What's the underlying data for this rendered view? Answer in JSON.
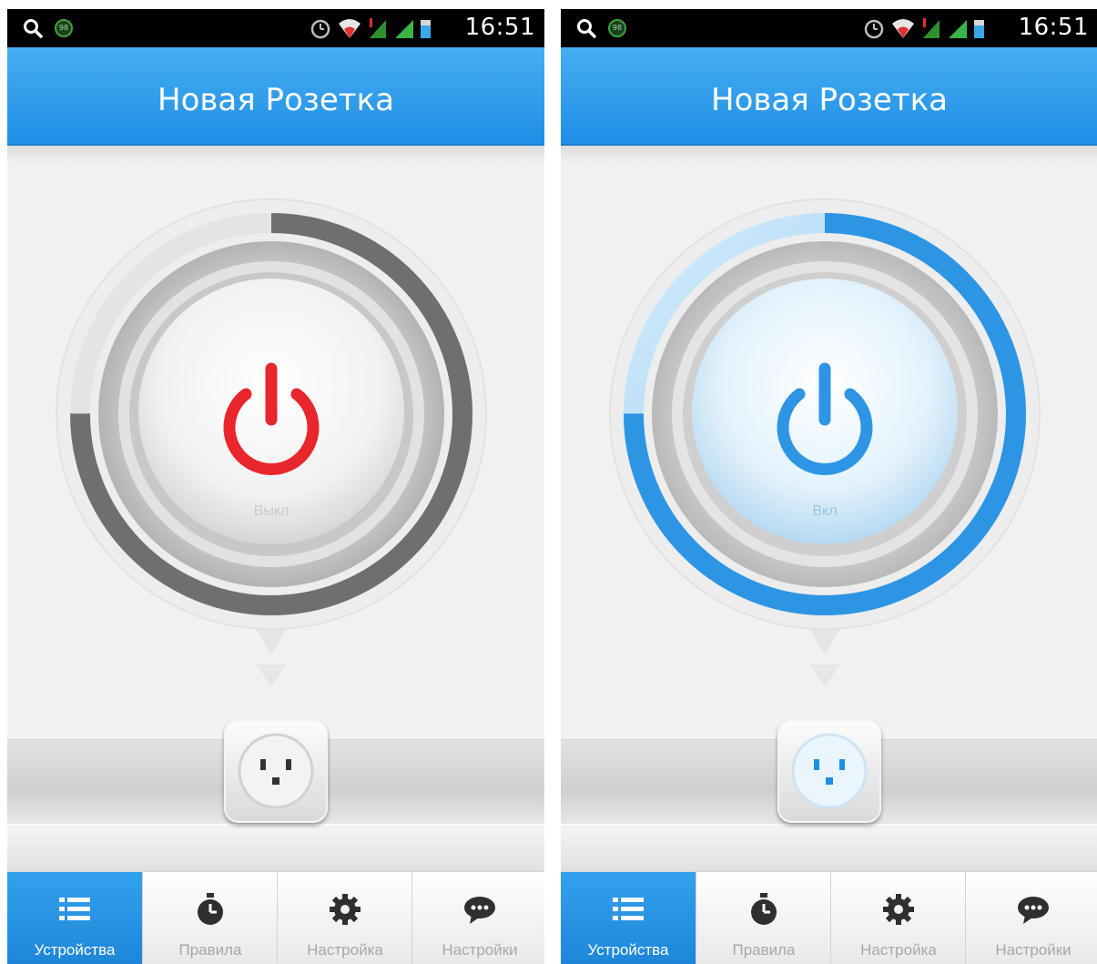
{
  "screens": [
    {
      "state": "off",
      "status_bar": {
        "time": "16:51",
        "badge": "98"
      },
      "header": {
        "title": "Новая Розетка"
      },
      "power": {
        "label": "Выкл",
        "icon_color": "#e8262c",
        "ring_color": "#6f6f6f"
      },
      "tabs": [
        {
          "label": "Устройства",
          "icon": "list-icon",
          "active": true
        },
        {
          "label": "Правила",
          "icon": "timer-icon",
          "active": false
        },
        {
          "label": "Настройка",
          "icon": "gear-icon",
          "active": false
        },
        {
          "label": "Настройки",
          "icon": "chat-icon",
          "active": false
        }
      ]
    },
    {
      "state": "on",
      "status_bar": {
        "time": "16:51",
        "badge": "98"
      },
      "header": {
        "title": "Новая Розетка"
      },
      "power": {
        "label": "Вкл",
        "icon_color": "#2d95e4",
        "ring_color": "#2d95e4"
      },
      "tabs": [
        {
          "label": "Устройства",
          "icon": "list-icon",
          "active": true
        },
        {
          "label": "Правила",
          "icon": "timer-icon",
          "active": false
        },
        {
          "label": "Настройка",
          "icon": "gear-icon",
          "active": false
        },
        {
          "label": "Настройки",
          "icon": "chat-icon",
          "active": false
        }
      ]
    }
  ],
  "colors": {
    "accent": "#1f8ee6",
    "off_icon": "#e8262c",
    "on_icon": "#2d95e4"
  }
}
